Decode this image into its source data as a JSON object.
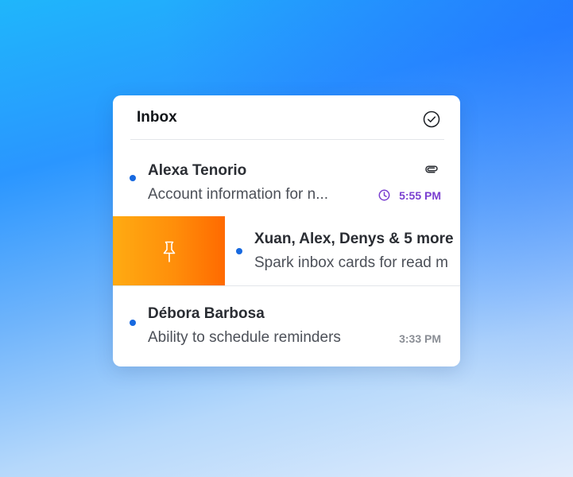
{
  "inbox": {
    "title": "Inbox"
  },
  "emails": [
    {
      "sender": "Alexa Tenorio",
      "subject": "Account information for n...",
      "time": "5:55 PM",
      "unread": true,
      "has_attachment": true,
      "reminder": true,
      "time_color": "#7a3fd0"
    },
    {
      "sender": "Xuan, Alex, Denys & 5 more",
      "subject": "Spark inbox cards for read m",
      "unread": true,
      "swipe_action_icon": "pin-icon"
    },
    {
      "sender": "Débora Barbosa",
      "subject": "Ability to schedule reminders",
      "time": "3:33 PM",
      "unread": true,
      "time_color": "#8a8e95"
    }
  ],
  "colors": {
    "unread_dot": "#1769e0",
    "pin_action": "#ff8e0a",
    "reminder_time": "#7a3fd0"
  }
}
